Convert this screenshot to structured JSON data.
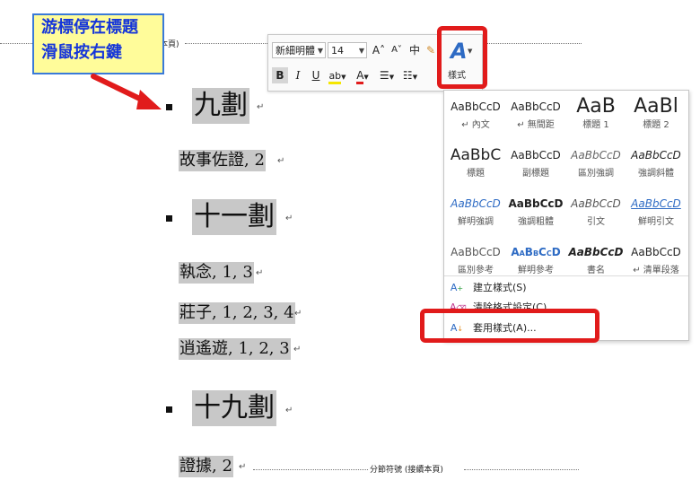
{
  "callout": {
    "line1": "游標停在標題",
    "line2": "滑鼠按右鍵"
  },
  "document": {
    "top_section_break": "本頁)",
    "bottom_section_break": "分節符號 (接續本頁)",
    "paragraph_mark": "↵",
    "headings": [
      "九劃",
      "十一劃",
      "十九劃"
    ],
    "entries": [
      "故事佐證, 2",
      "執念, 1, 3",
      "莊子, 1, 2, 3, 4",
      "逍遙遊, 1, 2, 3",
      "證據, 2"
    ]
  },
  "mini_toolbar": {
    "font_name": "新細明體",
    "font_size": "14",
    "grow_font": "A˄",
    "shrink_font": "A˅",
    "phonetic": "中",
    "bold": "B",
    "italic": "I",
    "underline": "U",
    "highlight": "ab",
    "font_color": "A",
    "styles_glyph": "A",
    "styles_label": "樣式"
  },
  "styles_gallery": {
    "rows": [
      [
        {
          "preview": "AaBbCcD",
          "name": "↵ 內文"
        },
        {
          "preview": "AaBbCcD",
          "name": "↵ 無間距"
        },
        {
          "preview": "AaB",
          "name": "標題 1"
        },
        {
          "preview": "AaBl",
          "name": "標題 2"
        }
      ],
      [
        {
          "preview": "AaBbC",
          "name": "標題"
        },
        {
          "preview": "AaBbCcD",
          "name": "副標題"
        },
        {
          "preview": "AaBbCcD",
          "name": "區別強調"
        },
        {
          "preview": "AaBbCcD",
          "name": "強調斜體"
        }
      ],
      [
        {
          "preview": "AaBbCcD",
          "name": "鮮明強調"
        },
        {
          "preview": "AaBbCcD",
          "name": "強調粗體"
        },
        {
          "preview": "AaBbCcD",
          "name": "引文"
        },
        {
          "preview": "AaBbCcD",
          "name": "鮮明引文"
        }
      ],
      [
        {
          "preview": "AaBbCcD",
          "name": "區別參考"
        },
        {
          "preview": "AaBbCcD",
          "name": "鮮明參考"
        },
        {
          "preview": "AaBbCcD",
          "name": "書名"
        },
        {
          "preview": "AaBbCcD",
          "name": "↵ 清單段落"
        }
      ]
    ],
    "commands": [
      {
        "label": "建立樣式(S)",
        "icon": "A"
      },
      {
        "label": "清除格式設定(C)",
        "icon": "A"
      },
      {
        "label": "套用樣式(A)...",
        "icon": "A"
      }
    ]
  },
  "colors": {
    "highlight_red": "#e11b1b",
    "callout_text": "#1535d9",
    "callout_bg": "#fffc9a",
    "accent_blue": "#2e6bc4"
  }
}
